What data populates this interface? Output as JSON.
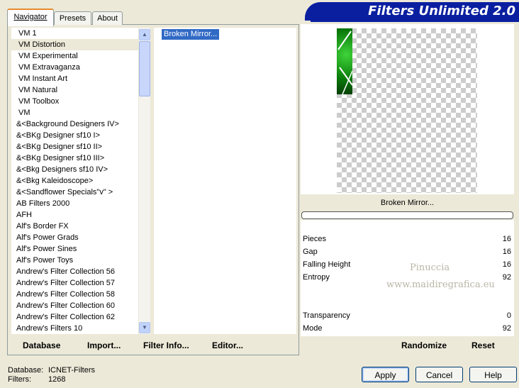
{
  "tabs": [
    {
      "label": "Navigator",
      "active": true
    },
    {
      "label": "Presets",
      "active": false
    },
    {
      "label": "About",
      "active": false
    }
  ],
  "banner_title": "Filters Unlimited 2.0",
  "categories": [
    "VM 1",
    "VM Distortion",
    "VM Experimental",
    "VM Extravaganza",
    "VM Instant Art",
    "VM Natural",
    "VM Toolbox",
    "VM",
    "&<Background Designers IV>",
    "&<BKg Designer sf10 I>",
    "&<BKg Designer sf10 II>",
    "&<BKg Designer sf10 III>",
    "&<Bkg Designers sf10 IV>",
    "&<Bkg Kaleidoscope>",
    "&<Sandflower Specials\"v\" >",
    "AB Filters 2000",
    "AFH",
    "Alf's Border FX",
    "Alf's Power Grads",
    "Alf's Power Sines",
    "Alf's Power Toys",
    "Andrew's Filter Collection 56",
    "Andrew's Filter Collection 57",
    "Andrew's Filter Collection 58",
    "Andrew's Filter Collection 60",
    "Andrew's Filter Collection 62",
    "Andrew's Filters 10"
  ],
  "selected_category": "VM Distortion",
  "filters": [
    "Broken Mirror..."
  ],
  "left_buttons": {
    "database": "Database",
    "import": "Import...",
    "filter_info": "Filter Info...",
    "editor": "Editor..."
  },
  "preview": {
    "filter_name": "Broken Mirror..."
  },
  "params": [
    {
      "label": "Pieces",
      "value": "16"
    },
    {
      "label": "Gap",
      "value": "16"
    },
    {
      "label": "Falling Height",
      "value": "16"
    },
    {
      "label": "Entropy",
      "value": "92"
    },
    {
      "label": "",
      "value": ""
    },
    {
      "label": "",
      "value": ""
    },
    {
      "label": "Transparency",
      "value": "0"
    },
    {
      "label": "Mode",
      "value": "92"
    }
  ],
  "watermark": {
    "line1": "Pinuccia",
    "line2": "www.maidiregrafica.eu"
  },
  "right_buttons": {
    "randomize": "Randomize",
    "reset": "Reset"
  },
  "status": {
    "database_label": "Database:",
    "database_value": "ICNET-Filters",
    "filters_label": "Filters:",
    "filters_value": "1268"
  },
  "dialog_buttons": {
    "apply": "Apply",
    "cancel": "Cancel",
    "help": "Help"
  }
}
